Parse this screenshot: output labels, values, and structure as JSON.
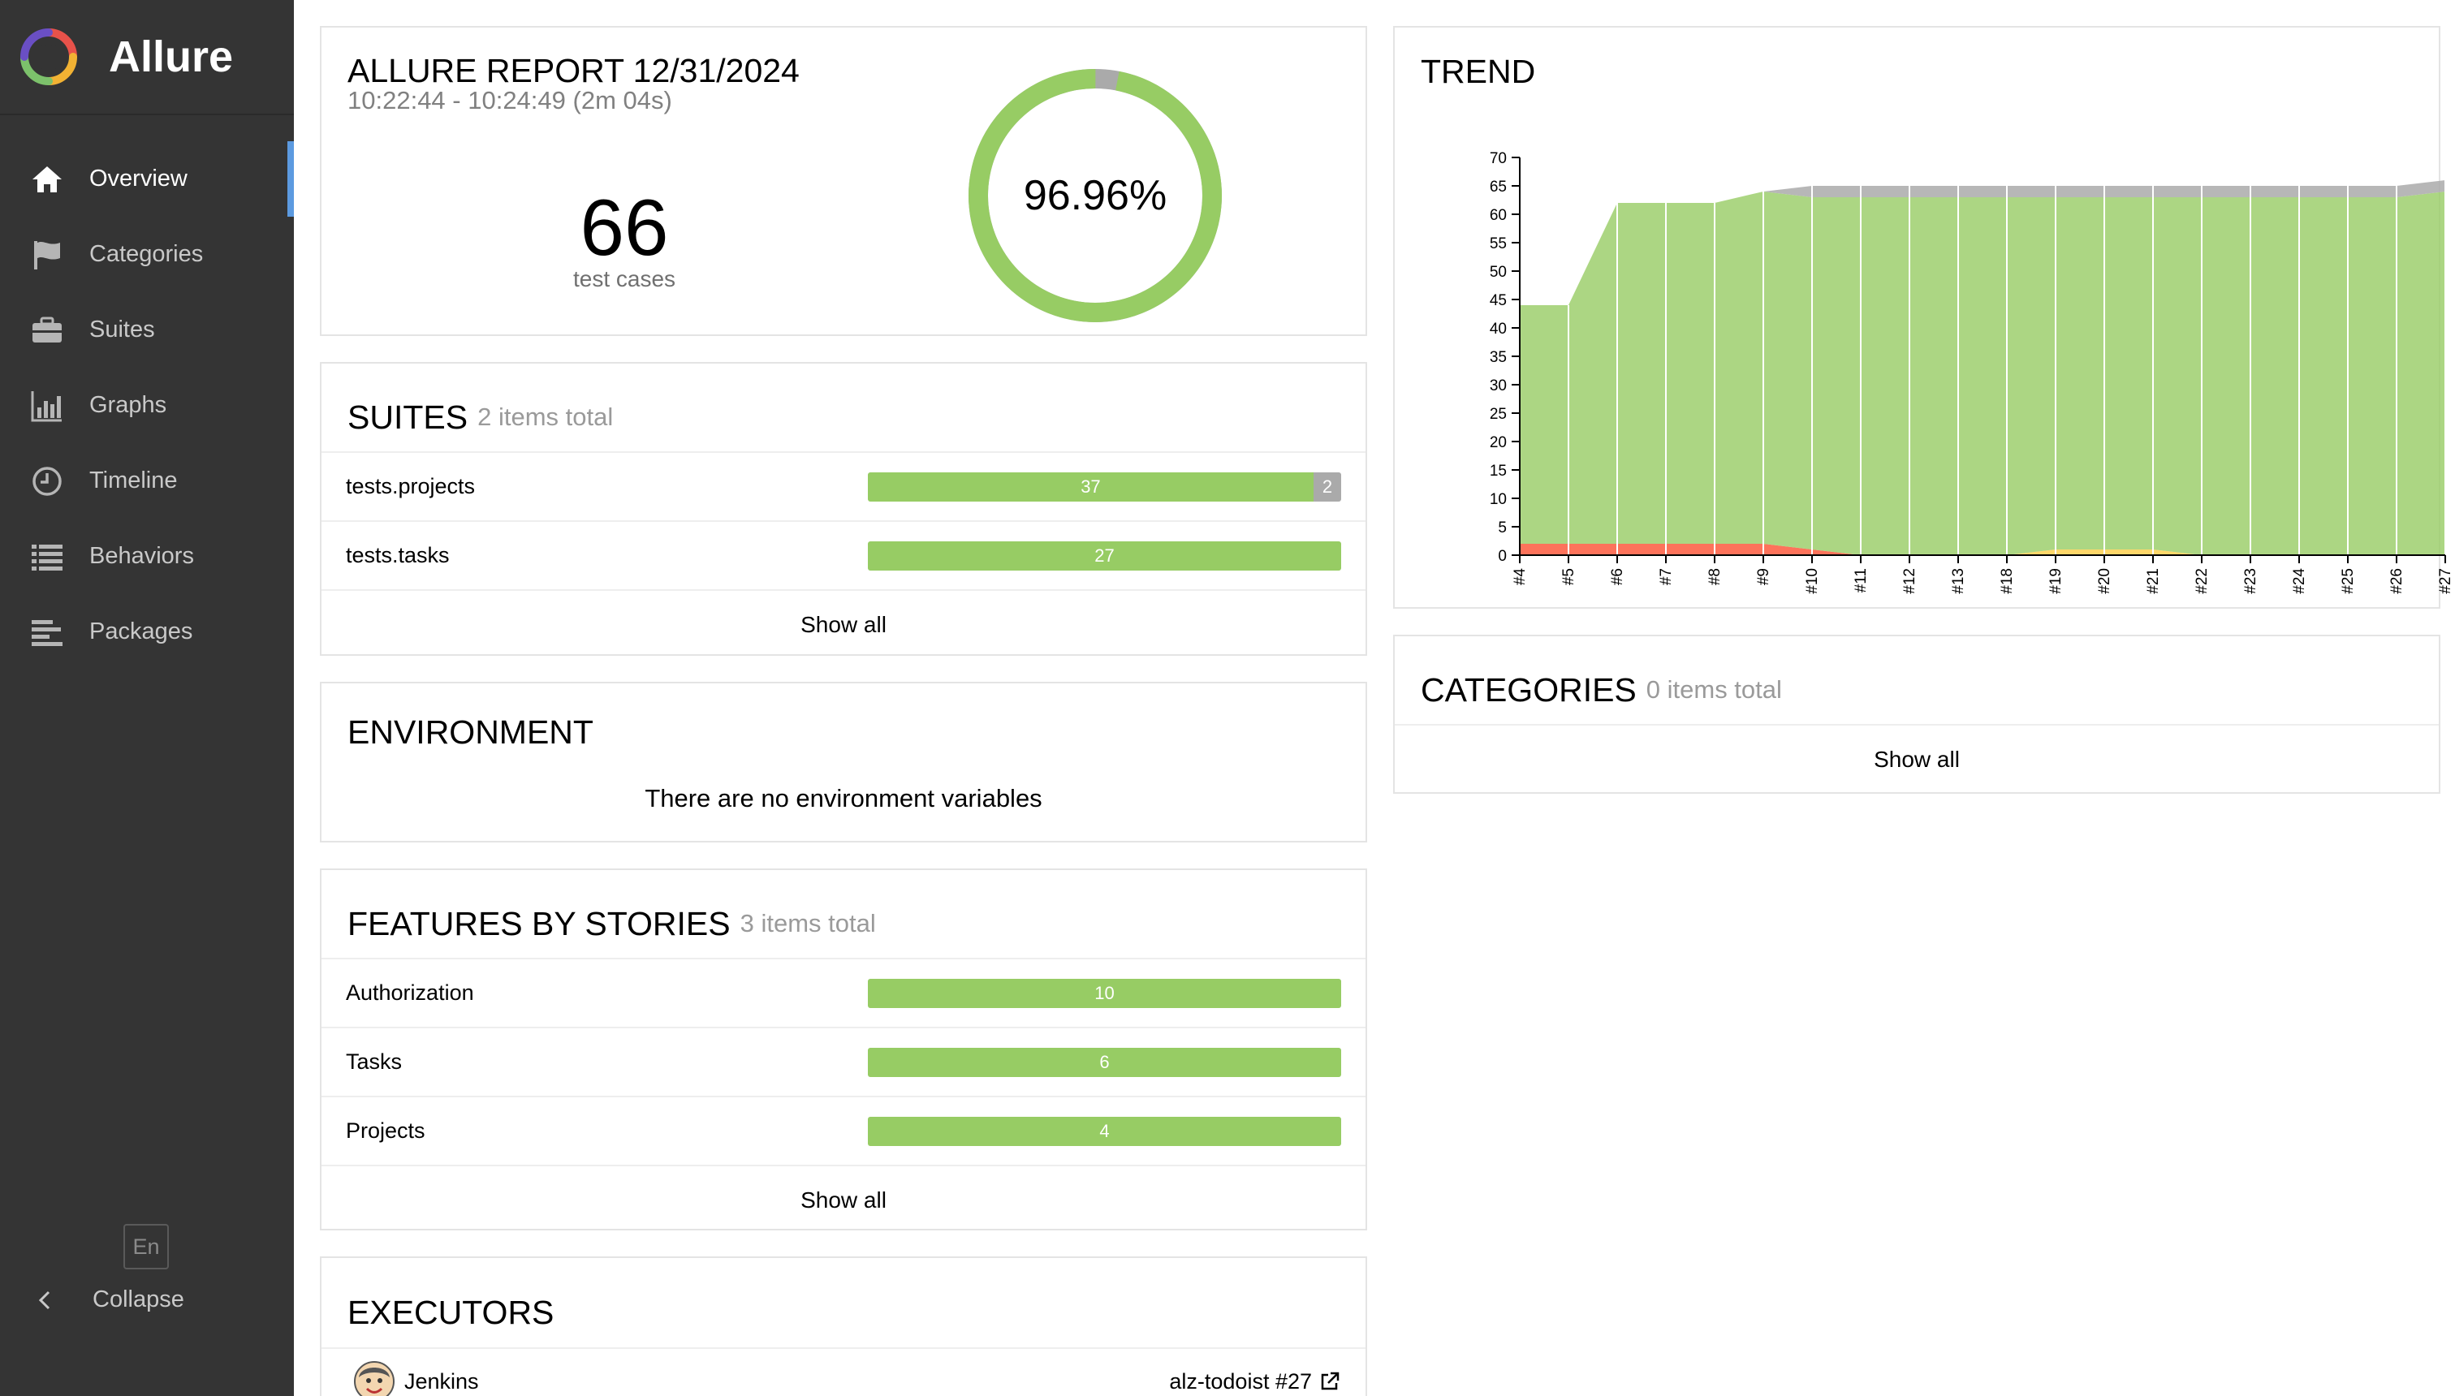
{
  "sidebar": {
    "brand": "Allure",
    "items": [
      {
        "label": "Overview",
        "icon": "home-icon",
        "active": true
      },
      {
        "label": "Categories",
        "icon": "flag-icon",
        "active": false
      },
      {
        "label": "Suites",
        "icon": "briefcase-icon",
        "active": false
      },
      {
        "label": "Graphs",
        "icon": "bar-chart-icon",
        "active": false
      },
      {
        "label": "Timeline",
        "icon": "clock-icon",
        "active": false
      },
      {
        "label": "Behaviors",
        "icon": "list-icon",
        "active": false
      },
      {
        "label": "Packages",
        "icon": "align-left-icon",
        "active": false
      }
    ],
    "language": "En",
    "collapse_label": "Collapse"
  },
  "report": {
    "title": "ALLURE REPORT 12/31/2024",
    "time_range": "10:22:44 - 10:24:49 (2m 04s)",
    "test_count": "66",
    "test_count_label": "test cases",
    "success_rate": "96.96%",
    "success_fraction": 0.9696
  },
  "suites": {
    "title": "SUITES",
    "subtitle": "2 items total",
    "rows": [
      {
        "name": "tests.projects",
        "passed": 37,
        "skipped": 2,
        "passed_label": "37",
        "skipped_label": "2"
      },
      {
        "name": "tests.tasks",
        "passed": 27,
        "skipped": 0,
        "passed_label": "27",
        "skipped_label": ""
      }
    ],
    "show_all": "Show all"
  },
  "environment": {
    "title": "ENVIRONMENT",
    "empty_message": "There are no environment variables"
  },
  "features": {
    "title": "FEATURES BY STORIES",
    "subtitle": "3 items total",
    "rows": [
      {
        "name": "Authorization",
        "passed": 10,
        "passed_label": "10"
      },
      {
        "name": "Tasks",
        "passed": 6,
        "passed_label": "6"
      },
      {
        "name": "Projects",
        "passed": 4,
        "passed_label": "4"
      }
    ],
    "show_all": "Show all"
  },
  "executors": {
    "title": "EXECUTORS",
    "rows": [
      {
        "name": "Jenkins",
        "build": "alz-todoist #27"
      }
    ]
  },
  "trend": {
    "title": "TREND"
  },
  "categories": {
    "title": "CATEGORIES",
    "subtitle": "0 items total",
    "show_all": "Show all"
  },
  "colors": {
    "passed": "#97cc64",
    "skipped": "#aaaaaa",
    "failed": "#fd5a3e",
    "broken": "#ffd050",
    "sidebar": "#343434",
    "active_accent": "#5c9ae0"
  },
  "chart_data": {
    "type": "area",
    "title": "TREND",
    "x": [
      "#4",
      "#5",
      "#6",
      "#7",
      "#8",
      "#9",
      "#10",
      "#11",
      "#12",
      "#13",
      "#18",
      "#19",
      "#20",
      "#21",
      "#22",
      "#23",
      "#24",
      "#25",
      "#26",
      "#27"
    ],
    "ylim": [
      0,
      70
    ],
    "yticks": [
      0,
      5,
      10,
      15,
      20,
      25,
      30,
      35,
      40,
      45,
      50,
      55,
      60,
      65,
      70
    ],
    "series": [
      {
        "name": "failed",
        "color": "#fd5a3e",
        "values": [
          2,
          2,
          2,
          2,
          2,
          2,
          1,
          0,
          0,
          0,
          0,
          0,
          0,
          0,
          0,
          0,
          0,
          0,
          0,
          0
        ]
      },
      {
        "name": "broken",
        "color": "#ffd050",
        "values": [
          0,
          0,
          0,
          0,
          0,
          0,
          0,
          0,
          0,
          0,
          0,
          1,
          1,
          1,
          0,
          0,
          0,
          0,
          0,
          0
        ]
      },
      {
        "name": "passed",
        "color": "#97cc64",
        "values": [
          42,
          42,
          60,
          60,
          60,
          62,
          62,
          63,
          63,
          63,
          63,
          62,
          62,
          62,
          63,
          63,
          63,
          63,
          63,
          64
        ]
      },
      {
        "name": "skipped",
        "color": "#aaaaaa",
        "values": [
          0,
          0,
          0,
          0,
          0,
          0,
          2,
          2,
          2,
          2,
          2,
          2,
          2,
          2,
          2,
          2,
          2,
          2,
          2,
          2
        ]
      }
    ]
  }
}
